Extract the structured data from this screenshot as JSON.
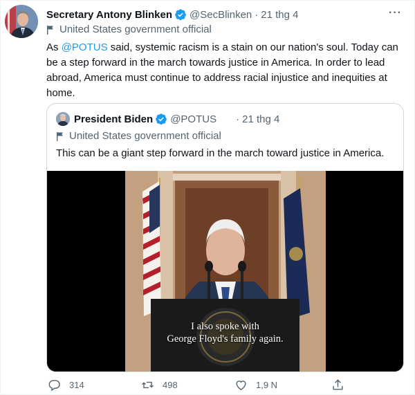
{
  "tweet": {
    "author_name": "Secretary Antony Blinken",
    "handle": "@SecBlinken",
    "separator": "·",
    "date": "21 thg 4",
    "more_label": "···",
    "gov_label": "United States government official",
    "text_before_mention": "As ",
    "mention": "@POTUS",
    "text_after_mention": " said, systemic racism is a stain on our nation's soul. Today can be a step forward in the march towards justice in America. In order to lead abroad, America must continue to address racial injustice and inequities at home."
  },
  "quoted_tweet": {
    "author_name": "President Biden",
    "handle": "@POTUS",
    "separator": "·",
    "date": "21 thg 4",
    "gov_label": "United States government official",
    "text": "This can be a giant step forward in the march toward justice in America.",
    "video_caption_line1": "I also spoke with",
    "video_caption_line2": "George Floyd's family again."
  },
  "actions": {
    "reply_count": "314",
    "retweet_count": "498",
    "like_count": "1,9 N"
  },
  "colors": {
    "accent": "#1d9bf0",
    "secondary_text": "#536471",
    "border": "#cfd9de"
  },
  "icons": [
    "verified-badge-icon",
    "government-flag-icon",
    "more-icon",
    "reply-icon",
    "retweet-icon",
    "like-icon",
    "share-icon"
  ]
}
